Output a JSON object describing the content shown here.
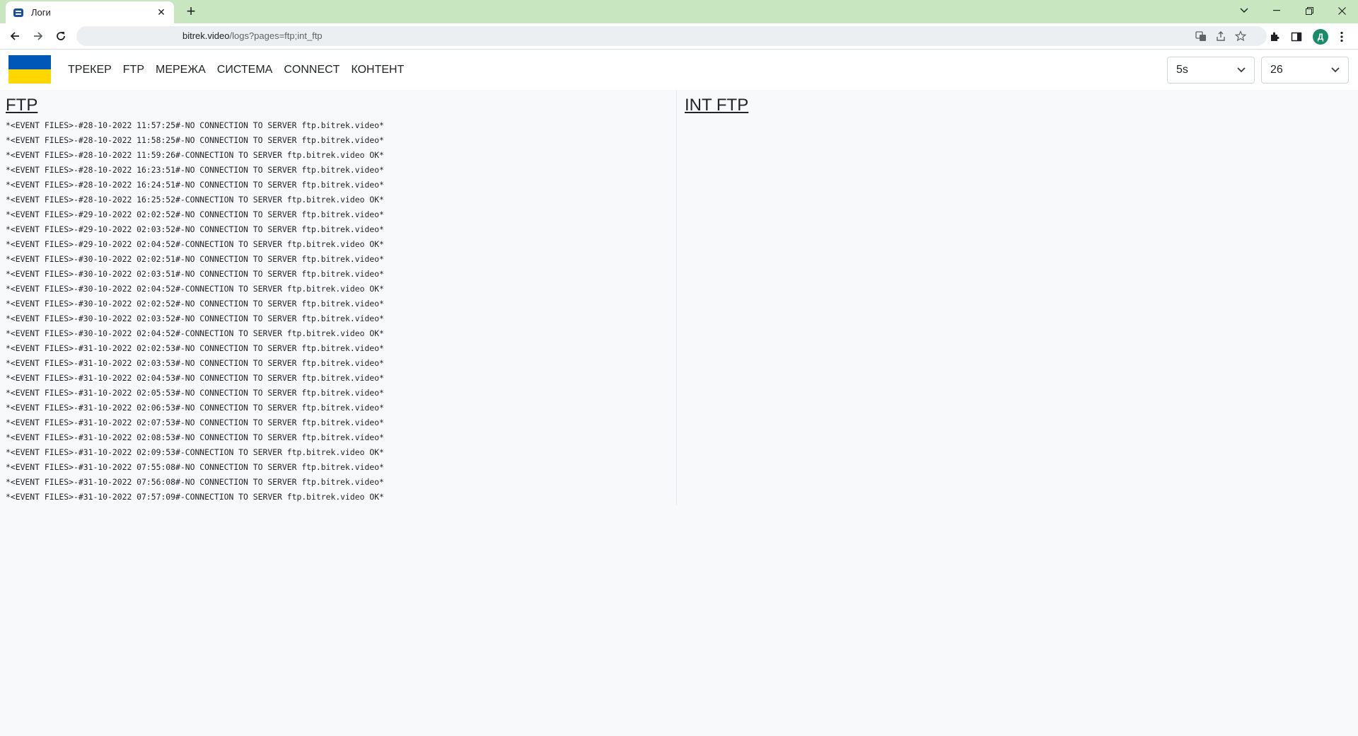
{
  "browser": {
    "tab_title": "Логи",
    "tab_close": "✕",
    "new_tab": "+",
    "url_domain": "bitrek.video",
    "url_path": "/logs?pages=ftp;int_ftp",
    "profile_initial": "Д",
    "icons": [
      "back-arrow-icon",
      "forward-arrow-icon",
      "reload-icon",
      "translate-icon",
      "share-icon",
      "star-icon",
      "extensions-icon",
      "side-panel-icon",
      "menu-kebab-icon"
    ]
  },
  "nav": {
    "flag_colors": [
      "#0057b8",
      "#ffd700"
    ],
    "items": [
      "ТРЕКЕР",
      "FTP",
      "МЕРЕЖА",
      "СИСТЕМА",
      "CONNECT",
      "КОНТЕНТ"
    ],
    "interval_select": "5s",
    "lines_select": "26"
  },
  "panels": {
    "ftp": {
      "title": "FTP",
      "lines": [
        "*<EVENT FILES>-#28-10-2022 11:57:25#-NO CONNECTION TO SERVER ftp.bitrek.video*",
        "*<EVENT FILES>-#28-10-2022 11:58:25#-NO CONNECTION TO SERVER ftp.bitrek.video*",
        "*<EVENT FILES>-#28-10-2022 11:59:26#-CONNECTION TO SERVER ftp.bitrek.video OK*",
        "*<EVENT FILES>-#28-10-2022 16:23:51#-NO CONNECTION TO SERVER ftp.bitrek.video*",
        "*<EVENT FILES>-#28-10-2022 16:24:51#-NO CONNECTION TO SERVER ftp.bitrek.video*",
        "*<EVENT FILES>-#28-10-2022 16:25:52#-CONNECTION TO SERVER ftp.bitrek.video OK*",
        "*<EVENT FILES>-#29-10-2022 02:02:52#-NO CONNECTION TO SERVER ftp.bitrek.video*",
        "*<EVENT FILES>-#29-10-2022 02:03:52#-NO CONNECTION TO SERVER ftp.bitrek.video*",
        "*<EVENT FILES>-#29-10-2022 02:04:52#-CONNECTION TO SERVER ftp.bitrek.video OK*",
        "*<EVENT FILES>-#30-10-2022 02:02:51#-NO CONNECTION TO SERVER ftp.bitrek.video*",
        "*<EVENT FILES>-#30-10-2022 02:03:51#-NO CONNECTION TO SERVER ftp.bitrek.video*",
        "*<EVENT FILES>-#30-10-2022 02:04:52#-CONNECTION TO SERVER ftp.bitrek.video OK*",
        "*<EVENT FILES>-#30-10-2022 02:02:52#-NO CONNECTION TO SERVER ftp.bitrek.video*",
        "*<EVENT FILES>-#30-10-2022 02:03:52#-NO CONNECTION TO SERVER ftp.bitrek.video*",
        "*<EVENT FILES>-#30-10-2022 02:04:52#-CONNECTION TO SERVER ftp.bitrek.video OK*",
        "*<EVENT FILES>-#31-10-2022 02:02:53#-NO CONNECTION TO SERVER ftp.bitrek.video*",
        "*<EVENT FILES>-#31-10-2022 02:03:53#-NO CONNECTION TO SERVER ftp.bitrek.video*",
        "*<EVENT FILES>-#31-10-2022 02:04:53#-NO CONNECTION TO SERVER ftp.bitrek.video*",
        "*<EVENT FILES>-#31-10-2022 02:05:53#-NO CONNECTION TO SERVER ftp.bitrek.video*",
        "*<EVENT FILES>-#31-10-2022 02:06:53#-NO CONNECTION TO SERVER ftp.bitrek.video*",
        "*<EVENT FILES>-#31-10-2022 02:07:53#-NO CONNECTION TO SERVER ftp.bitrek.video*",
        "*<EVENT FILES>-#31-10-2022 02:08:53#-NO CONNECTION TO SERVER ftp.bitrek.video*",
        "*<EVENT FILES>-#31-10-2022 02:09:53#-CONNECTION TO SERVER ftp.bitrek.video OK*",
        "*<EVENT FILES>-#31-10-2022 07:55:08#-NO CONNECTION TO SERVER ftp.bitrek.video*",
        "*<EVENT FILES>-#31-10-2022 07:56:08#-NO CONNECTION TO SERVER ftp.bitrek.video*",
        "*<EVENT FILES>-#31-10-2022 07:57:09#-CONNECTION TO SERVER ftp.bitrek.video OK*"
      ]
    },
    "int_ftp": {
      "title": "INT FTP",
      "lines": []
    }
  }
}
